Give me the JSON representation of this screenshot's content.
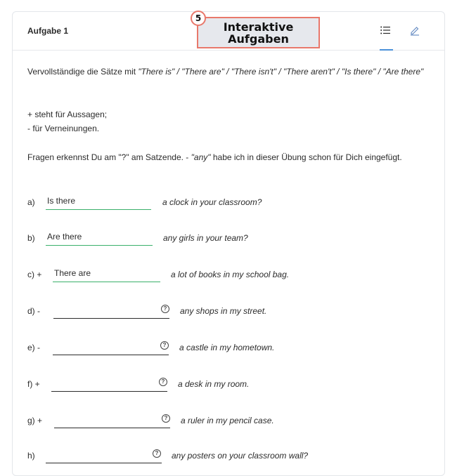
{
  "header": {
    "task_title": "Aufgabe 1",
    "list_icon": "list-icon",
    "edit_icon": "pencil-icon"
  },
  "overlay": {
    "badge": "5",
    "label": "Interaktive\nAufgaben"
  },
  "instructions": {
    "intro_prefix": "Vervollständige die Sätze mit ",
    "intro_options": "\"There is\" / \"There are\" / \"There isn't\" / \"There aren't\" / \"Is there\" / \"Are there\"",
    "plus_line": "+ steht für Aussagen;",
    "minus_line": "- für Verneinungen.",
    "questions_prefix": "Fragen erkennst Du am \"?\" am Satzende. - ",
    "questions_any": "\"any\"",
    "questions_suffix": " habe ich in dieser Übung schon für Dich eingefügt."
  },
  "exercises": [
    {
      "label": "a)",
      "answer": "Is there",
      "rest": "a clock in your classroom?"
    },
    {
      "label": "b)",
      "answer": "Are there",
      "rest": "any girls in your team?"
    },
    {
      "label": "c) +",
      "answer": "There are",
      "rest": "a lot of books in my school bag."
    },
    {
      "label": "d) -",
      "answer": "",
      "rest": "any shops in my street."
    },
    {
      "label": "e) -",
      "answer": "",
      "rest": "a castle in my hometown."
    },
    {
      "label": "f) +",
      "answer": "",
      "rest": "a desk in my room."
    },
    {
      "label": "g) +",
      "answer": "",
      "rest": "a ruler in my pencil case."
    },
    {
      "label": "h)",
      "answer": "",
      "rest": "any posters on your classroom wall?"
    }
  ],
  "help_glyph": "?",
  "colors": {
    "answered_line": "#3ab06a",
    "accent": "#4a90d9",
    "overlay_border": "#e8786b"
  }
}
